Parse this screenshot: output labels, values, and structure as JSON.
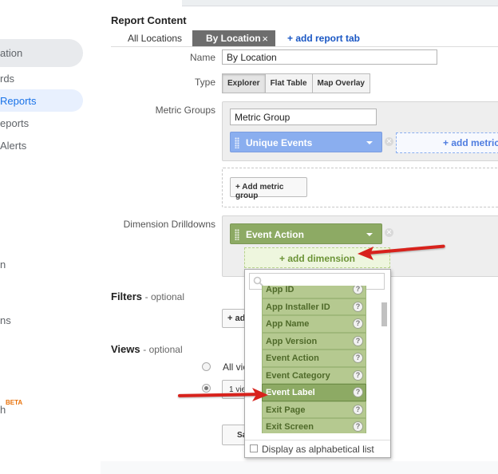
{
  "sidebar": {
    "items": [
      {
        "label": "ation"
      },
      {
        "label": "rds"
      },
      {
        "label": "Reports"
      },
      {
        "label": "eports"
      },
      {
        "label": "Alerts"
      },
      {
        "label": "n"
      },
      {
        "label": "ns"
      },
      {
        "label": "h"
      }
    ],
    "beta": "BETA"
  },
  "report": {
    "title": "Report Content",
    "tabs": [
      "All Locations",
      "By Location"
    ],
    "close_glyph": "×",
    "add_tab": "+ add report tab",
    "name_label": "Name",
    "name_value": "By Location",
    "type_label": "Type",
    "types": [
      "Explorer",
      "Flat Table",
      "Map Overlay"
    ],
    "metric_groups_label": "Metric Groups",
    "metric_group_name": "Metric Group",
    "metric_chip": "Unique Events",
    "add_metric": "+ add metric",
    "add_metric_group": "+ Add metric group",
    "dimension_label": "Dimension Drilldowns",
    "dimension_chip": "Event Action",
    "add_dimension": "+ add dimension",
    "filters_title": "Filters",
    "filters_optional": "- optional",
    "filters_btn": "+ ad",
    "views_title": "Views",
    "views_optional": "- optional",
    "views_all": "All vie",
    "views_one": "1 vie",
    "save_label": "Sa"
  },
  "dropdown": {
    "items": [
      {
        "label": "App ID",
        "selected": false
      },
      {
        "label": "App Installer ID",
        "selected": false
      },
      {
        "label": "App Name",
        "selected": false
      },
      {
        "label": "App Version",
        "selected": false
      },
      {
        "label": "Event Action",
        "selected": false
      },
      {
        "label": "Event Category",
        "selected": false
      },
      {
        "label": "Event Label",
        "selected": true
      },
      {
        "label": "Exit Page",
        "selected": false
      },
      {
        "label": "Exit Screen",
        "selected": false
      }
    ],
    "help_glyph": "?",
    "alpha_label": "Display as alphabetical list"
  },
  "colors": {
    "metric_chip": "#8aaeef",
    "dimension_chip": "#8daa64",
    "link": "#1a57c4",
    "arrow": "#d8221c"
  }
}
